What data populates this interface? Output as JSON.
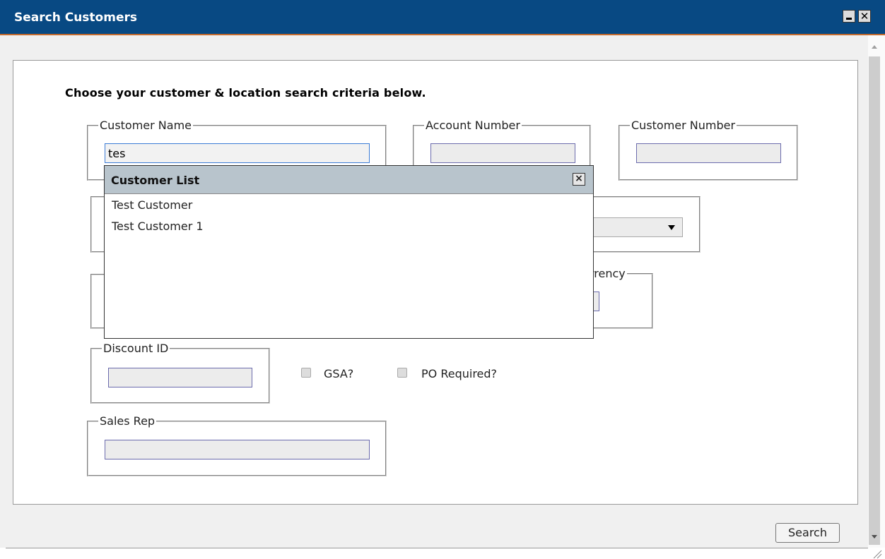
{
  "window": {
    "title": "Search Customers"
  },
  "form": {
    "heading": "Choose your customer & location search criteria below.",
    "customer_name": {
      "legend": "Customer Name",
      "value": "tes"
    },
    "account_number": {
      "legend": "Account Number",
      "value": ""
    },
    "customer_number": {
      "legend": "Customer Number",
      "value": ""
    },
    "currency": {
      "legend_partial": "rrency"
    },
    "discount_id": {
      "legend": "Discount ID",
      "value": ""
    },
    "gsa": {
      "label": "GSA?",
      "checked": false
    },
    "po_required": {
      "label": "PO Required?",
      "checked": false
    },
    "sales_rep": {
      "legend": "Sales Rep",
      "value": ""
    },
    "search_button": "Search"
  },
  "popup": {
    "title": "Customer List",
    "close_symbol": "×",
    "items": [
      "Test Customer",
      "Test Customer 1"
    ]
  },
  "icons": {
    "minimize": "minimize-icon",
    "close": "close-icon",
    "dropdown": "triangle-down-icon"
  },
  "colors": {
    "titlebar": "#084983",
    "titlebar_accent": "#c46a2c",
    "popup_header": "#b8c4cc"
  }
}
